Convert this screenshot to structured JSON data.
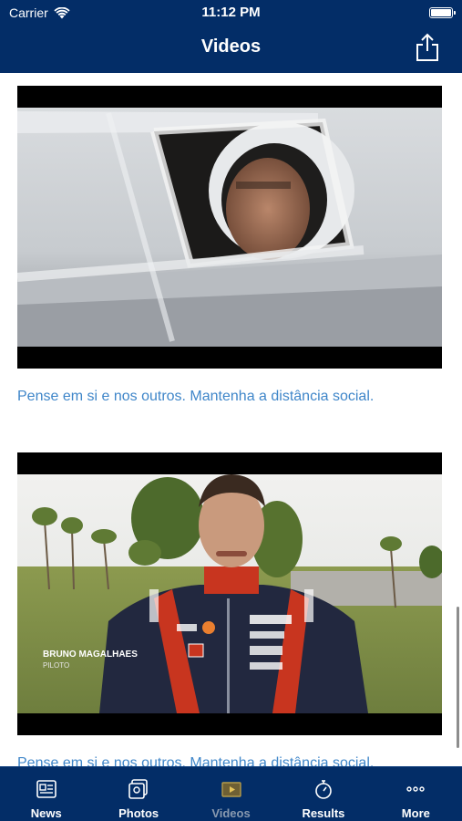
{
  "status_bar": {
    "carrier": "Carrier",
    "time": "11:12 PM"
  },
  "header": {
    "title": "Videos",
    "share_icon": "share-icon"
  },
  "videos": [
    {
      "caption": "Pense em si e nos outros. Mantenha a distância social.",
      "thumbnail": "driver in helmet behind car window"
    },
    {
      "caption": "Pense em si e nos outros. Mantenha a distância social.",
      "thumbnail_text": [
        "BRUNO MAGALHAES",
        "PILOTO"
      ],
      "suit_logos": [
        "galp",
        "HYUNDAI",
        "sparco",
        "ERA",
        "netelem"
      ]
    }
  ],
  "tabs": [
    {
      "label": "News",
      "icon": "news-icon",
      "active": false
    },
    {
      "label": "Photos",
      "icon": "photos-icon",
      "active": false
    },
    {
      "label": "Videos",
      "icon": "videos-icon",
      "active": true
    },
    {
      "label": "Results",
      "icon": "stopwatch-icon",
      "active": false
    },
    {
      "label": "More",
      "icon": "more-icon",
      "active": false
    }
  ],
  "colors": {
    "header_bg": "#032d67",
    "tab_bar_bg": "#032d67",
    "link_blue": "#3f86c9",
    "tab_inactive": "#ffffff",
    "tab_active": "#8a9ab0"
  }
}
